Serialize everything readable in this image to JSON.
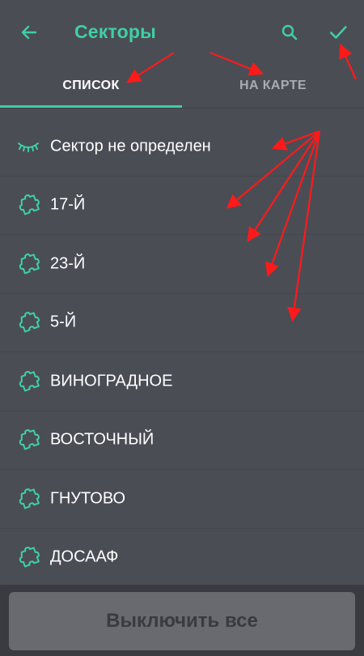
{
  "colors": {
    "accent": "#3ed0a2",
    "background": "#4b4d55",
    "annotation": "#ff1a1a"
  },
  "appbar": {
    "title": "Секторы",
    "back_icon": "arrow-left-icon",
    "search_icon": "search-icon",
    "confirm_icon": "check-icon"
  },
  "tabs": [
    {
      "label": "СПИСОК",
      "selected": true
    },
    {
      "label": "НА КАРТЕ",
      "selected": false
    }
  ],
  "sectors": [
    {
      "label": "Сектор не определен",
      "icon": "closed-eye-icon"
    },
    {
      "label": "17-Й",
      "icon": "puzzle-piece-icon"
    },
    {
      "label": "23-Й",
      "icon": "puzzle-piece-icon"
    },
    {
      "label": "5-Й",
      "icon": "puzzle-piece-icon"
    },
    {
      "label": "ВИНОГРАДНОЕ",
      "icon": "puzzle-piece-icon"
    },
    {
      "label": "ВОСТОЧНЫЙ",
      "icon": "puzzle-piece-icon"
    },
    {
      "label": "ГНУТОВО",
      "icon": "puzzle-piece-icon"
    },
    {
      "label": "ДОСААФ",
      "icon": "puzzle-piece-icon"
    }
  ],
  "footer": {
    "button_label": "Выключить все"
  }
}
